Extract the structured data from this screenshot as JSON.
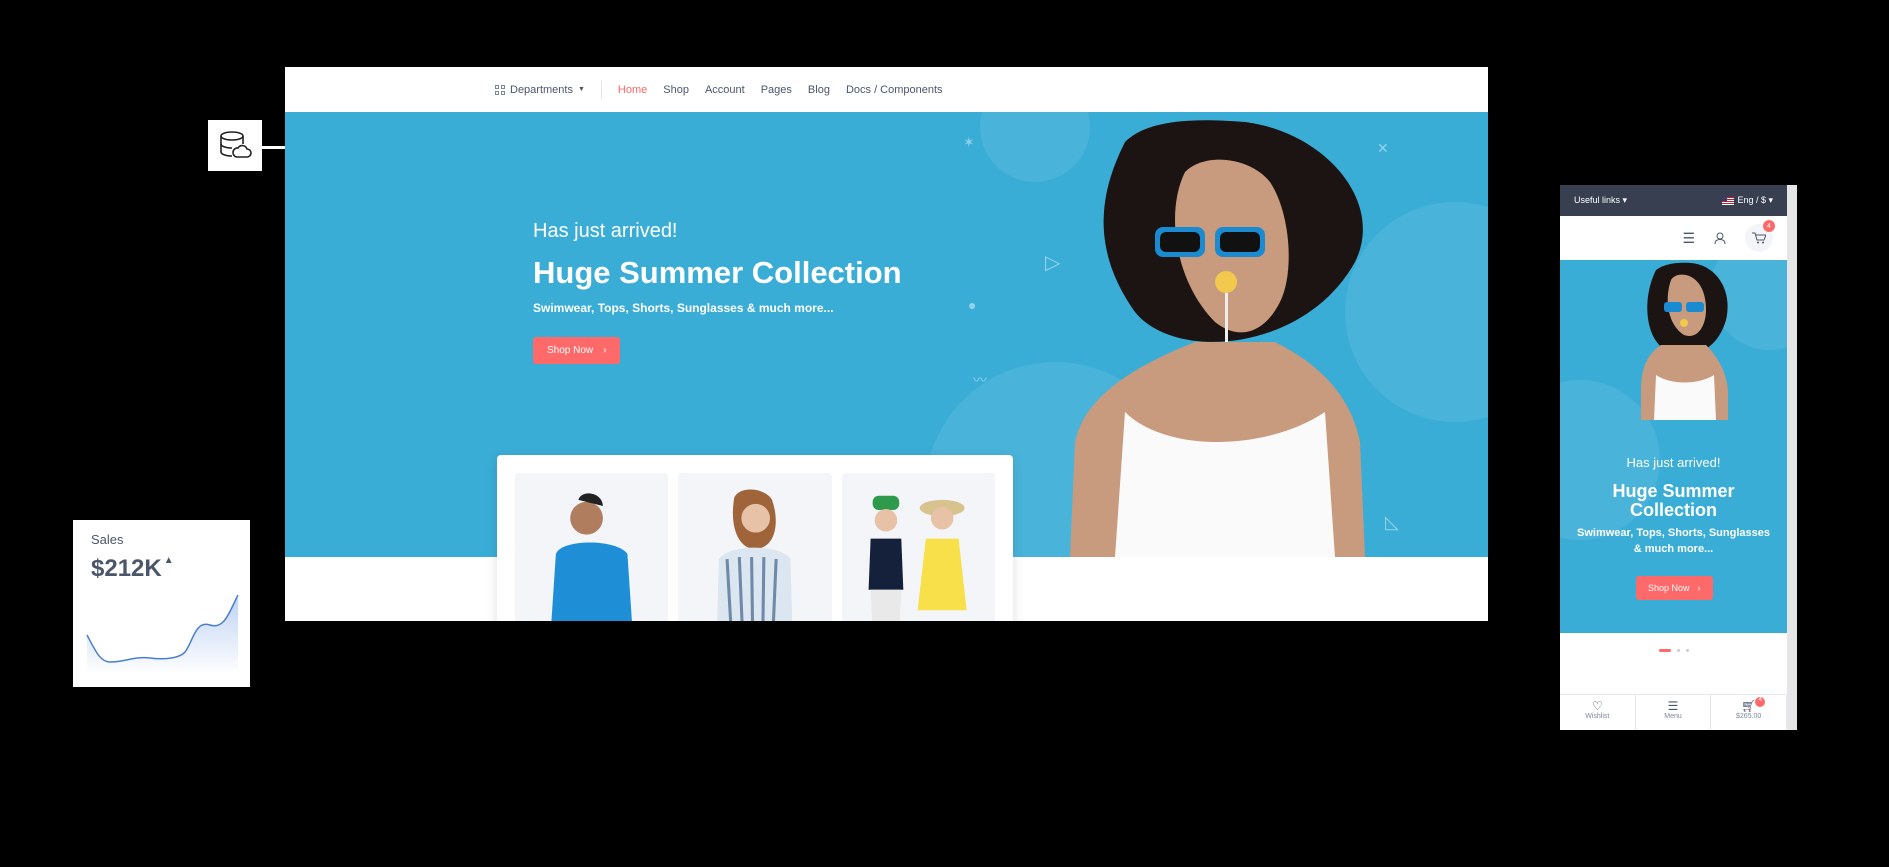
{
  "desktop": {
    "nav": {
      "departments_label": "Departments",
      "items": [
        {
          "label": "Home",
          "active": true
        },
        {
          "label": "Shop"
        },
        {
          "label": "Account"
        },
        {
          "label": "Pages"
        },
        {
          "label": "Blog"
        },
        {
          "label": "Docs / Components"
        }
      ]
    },
    "hero": {
      "subtitle": "Has just arrived!",
      "title": "Huge Summer Collection",
      "description": "Swimwear, Tops, Shorts, Sunglasses & much more...",
      "button_label": "Shop Now"
    }
  },
  "mobile": {
    "topbar": {
      "useful_links": "Useful links",
      "locale": "Eng / $"
    },
    "cart_count": "4",
    "hero": {
      "subtitle": "Has just arrived!",
      "title": "Huge Summer Collection",
      "description": "Swimwear, Tops, Shorts, Sunglasses & much more...",
      "button_label": "Shop Now"
    },
    "bottom_bar": {
      "wishlist": "Wishlist",
      "menu": "Menu",
      "cart_total": "$265.00",
      "cart_badge": "4"
    }
  },
  "sales_widget": {
    "label": "Sales",
    "value": "$212K",
    "trend": "up"
  },
  "icons": [
    "database-cloud-icon",
    "menu-icon",
    "user-icon",
    "cart-icon",
    "heart-icon",
    "chevron-right-icon"
  ],
  "colors": {
    "accent": "#fe696a",
    "hero_bg": "#3aadd7",
    "text": "#4b566b"
  }
}
